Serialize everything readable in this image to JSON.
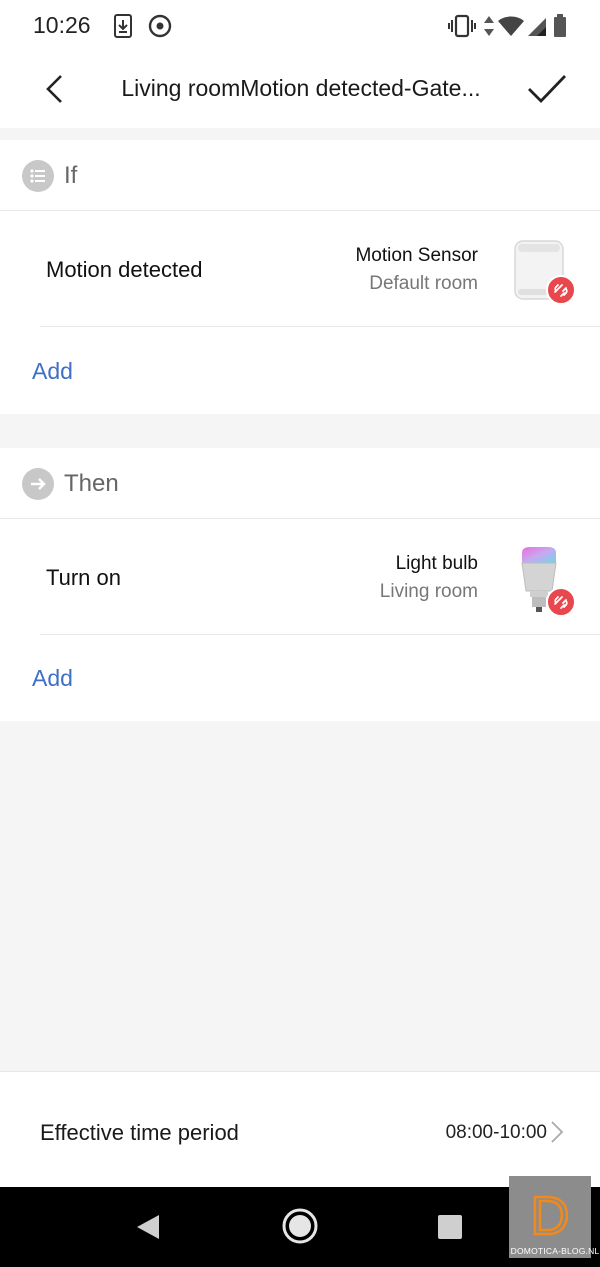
{
  "status_bar": {
    "time": "10:26",
    "icons": [
      "download-icon",
      "target-icon",
      "vibrate-icon",
      "data-arrows-icon",
      "wifi-icon",
      "signal-icon",
      "battery-icon"
    ]
  },
  "header": {
    "title": "Living roomMotion detected-Gate...",
    "back_icon": "chevron-left-icon",
    "confirm_icon": "checkmark-icon"
  },
  "if_section": {
    "label": "If",
    "icon": "list-icon",
    "conditions": [
      {
        "label": "Motion detected",
        "device_name": "Motion Sensor",
        "device_room": "Default room",
        "badge_icon": "link-broken-icon"
      }
    ],
    "add_label": "Add"
  },
  "then_section": {
    "label": "Then",
    "icon": "arrow-right-icon",
    "actions": [
      {
        "label": "Turn on",
        "device_name": "Light bulb",
        "device_room": "Living room",
        "badge_icon": "link-broken-icon"
      }
    ],
    "add_label": "Add"
  },
  "effective_period": {
    "label": "Effective time period",
    "value": "08:00-10:00"
  },
  "nav_bar": {
    "icons": [
      "back-triangle-icon",
      "home-circle-icon",
      "recents-square-icon"
    ]
  },
  "watermark": {
    "letter": "D",
    "text": "DOMOTICA-BLOG.NL"
  },
  "colors": {
    "accent_link": "#3f6fc7",
    "badge_red": "#e8474e",
    "watermark_orange": "#f08a1c"
  }
}
